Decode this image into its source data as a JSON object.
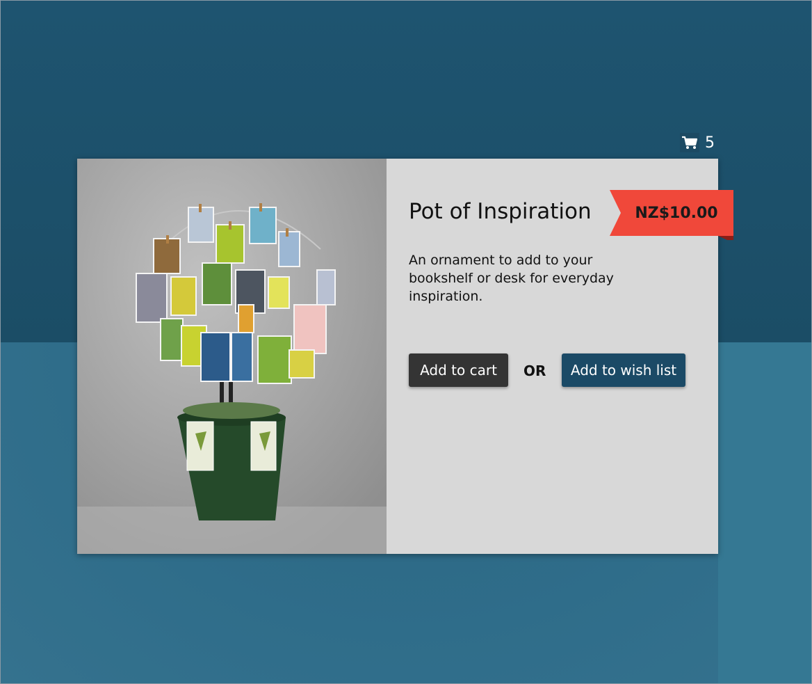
{
  "cart": {
    "icon": "shopping-cart-icon",
    "count": "5"
  },
  "product": {
    "title": "Pot of Inspiration",
    "price": "NZ$10.00",
    "description": "An ornament to add to your bookshelf or desk for everyday inspiration.",
    "image": "potted-stamp-tree-photo"
  },
  "actions": {
    "add_to_cart": "Add to cart",
    "or": "OR",
    "add_to_wishlist": "Add to wish list"
  },
  "colors": {
    "background_top": "#1b4d66",
    "background_bottom": "#2f6d8a",
    "card": "#d8d8d8",
    "cart_button": "#343434",
    "wishlist_button": "#1b4a66",
    "price_tag": "#f0483a"
  }
}
